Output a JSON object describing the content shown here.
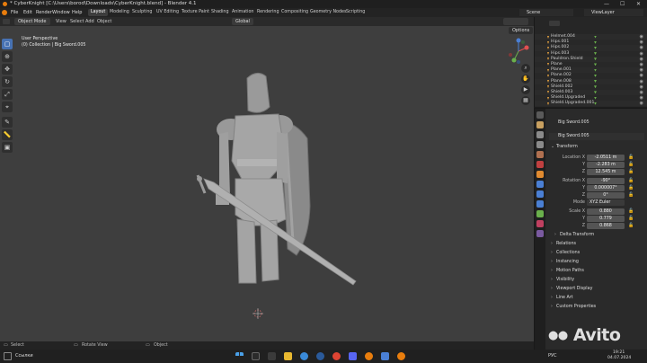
{
  "window": {
    "title": "* CyberKnight [C:\\Users\\borod\\Downloads\\CyberKnight.blend] - Blender 4.1",
    "controls": [
      "—",
      "☐",
      "✕"
    ]
  },
  "menu": {
    "items": [
      "File",
      "Edit",
      "Render",
      "Window",
      "Help"
    ],
    "workspaces": [
      "Layout",
      "Modeling",
      "Sculpting",
      "UV Editing",
      "Texture Paint",
      "Shading",
      "Animation",
      "Rendering",
      "Compositing",
      "Geometry Nodes",
      "Scripting"
    ],
    "active_workspace": "Layout",
    "scene": "Scene",
    "view_layer": "ViewLayer"
  },
  "viewport": {
    "mode": "Object Mode",
    "menus": [
      "View",
      "Select",
      "Add",
      "Object"
    ],
    "orientation": "Global",
    "options": "Options",
    "overlay_line1": "User Perspective",
    "overlay_line2": "(0) Collection | Big Sword.005"
  },
  "status": {
    "select": "Select",
    "rotate": "Rotate View",
    "object": "Object"
  },
  "outliner": {
    "items": [
      "Helmet.004",
      "Hips.001",
      "Hips.002",
      "Hips.003",
      "Pauldron.Shield",
      "Plane",
      "Plane.001",
      "Plane.002",
      "Plane.008",
      "Shield.002",
      "Shield.003",
      "Shield.Upgraded",
      "Shield.Upgraded.001"
    ]
  },
  "properties": {
    "object_name_top": "Big Sword.005",
    "object_name": "Big Sword.005",
    "transform_title": "Transform",
    "location": {
      "label": "Location X",
      "x": "-2.0511 m",
      "y": "-2.283 m",
      "z": "12.545 m"
    },
    "rotation": {
      "label": "Rotation X",
      "x": "-90°",
      "y": "0.000007°",
      "z": "0°"
    },
    "mode": {
      "label": "Mode",
      "value": "XYZ Euler"
    },
    "scale": {
      "label": "Scale X",
      "x": "0.880",
      "y": "0.779",
      "z": "0.868"
    },
    "axis_y": "Y",
    "axis_z": "Z",
    "sections": [
      "Delta Transform",
      "Relations",
      "Collections",
      "Instancing",
      "Motion Paths",
      "Visibility",
      "Viewport Display",
      "Line Art",
      "Custom Properties"
    ]
  },
  "taskbar": {
    "left_label": "Ссылки",
    "lang": "РУС",
    "time": "19:21",
    "date": "04.07.2024"
  },
  "watermark": "Avito",
  "colors": {
    "viewport_bg": "#3e3e3e",
    "accent_blue": "#4772b3",
    "blender_orange": "#e87d0d"
  }
}
